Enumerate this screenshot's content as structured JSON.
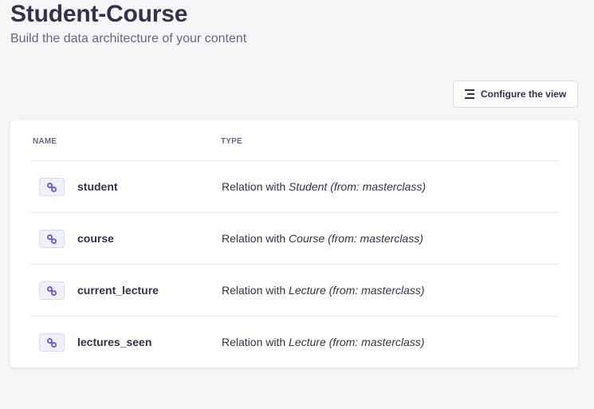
{
  "header": {
    "title": "Student-Course",
    "subtitle": "Build the data architecture of your content"
  },
  "toolbar": {
    "configure_label": "Configure the view"
  },
  "table": {
    "columns": [
      "Name",
      "Type"
    ],
    "rows": [
      {
        "name": "student",
        "type_prefix": "Relation with",
        "target": "Student",
        "source": "(from: masterclass)",
        "icon": "relation-link-icon"
      },
      {
        "name": "course",
        "type_prefix": "Relation with",
        "target": "Course",
        "source": "(from: masterclass)",
        "icon": "relation-link-icon"
      },
      {
        "name": "current_lecture",
        "type_prefix": "Relation with",
        "target": "Lecture",
        "source": "(from: masterclass)",
        "icon": "relation-link-icon"
      },
      {
        "name": "lectures_seen",
        "type_prefix": "Relation with",
        "target": "Lecture",
        "source": "(from: masterclass)",
        "icon": "relation-link-icon"
      }
    ]
  },
  "colors": {
    "background": "#f6f6f9",
    "accent": "#4945ff",
    "icon_bg": "#f0f0ff",
    "text": "#32324d",
    "muted": "#666687"
  }
}
